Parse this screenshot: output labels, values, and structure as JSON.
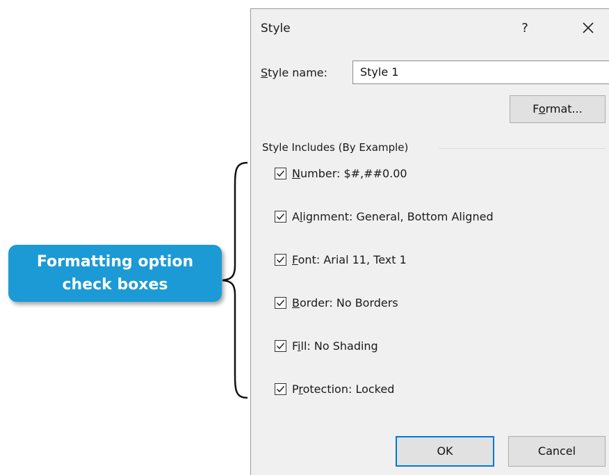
{
  "callout": {
    "line1": "Formatting option",
    "line2": "check boxes",
    "color": "#1b9ad6"
  },
  "dialog": {
    "title": "Style",
    "help_label": "?",
    "close_icon": "close-icon",
    "style_name_label_first": "S",
    "style_name_label_rest": "tyle name:",
    "style_name_value": "Style 1",
    "format_button_pre": "F",
    "format_button_u": "o",
    "format_button_post": "rmat...",
    "group_label": "Style Includes (By Example)",
    "options": [
      {
        "u": "N",
        "rest": "umber: $#,##0.00",
        "checked": true
      },
      {
        "pre": "A",
        "u": "l",
        "rest": "ignment: General, Bottom Aligned",
        "checked": true
      },
      {
        "u": "F",
        "rest": "ont: Arial 11, Text 1",
        "checked": true
      },
      {
        "u": "B",
        "rest": "order: No Borders",
        "checked": true
      },
      {
        "pre": "F",
        "u": "i",
        "rest": "ll: No Shading",
        "checked": true
      },
      {
        "pre": "P",
        "u": "r",
        "rest": "otection: Locked",
        "checked": true
      }
    ],
    "ok_label": "OK",
    "cancel_label": "Cancel",
    "accent_color": "#0078d7"
  }
}
